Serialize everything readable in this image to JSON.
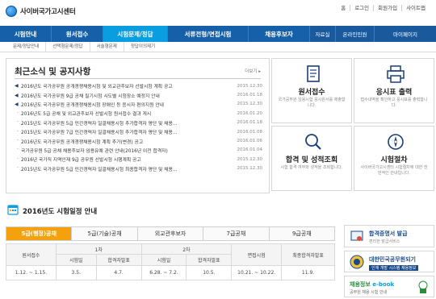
{
  "header": {
    "site_name": "사이버국가고시센터",
    "util": [
      "홈",
      "로그인",
      "회원가입",
      "사이트맵"
    ]
  },
  "gnb": {
    "items": [
      "시험안내",
      "원서접수",
      "시험문제/정답",
      "서류전형/면접시험",
      "채용후보자",
      "자료실",
      "온라인민원",
      "마이페이지"
    ],
    "active_index": 2
  },
  "snb": {
    "items": [
      "문제/정답안내",
      "선택형문제/정답",
      "서술형문제",
      "정답이의제기"
    ]
  },
  "news": {
    "title": "최근소식 및 공지사항",
    "more": "더보기",
    "items": [
      {
        "type": "notice",
        "title": "2016년도 국가공무원 공개경쟁채용시험 및 외교관후보자 선발시험 계획 공고",
        "date": "2015.12.30"
      },
      {
        "type": "notice",
        "title": "2016년도 국가공무원 9급 공채 필기시험 시도별 시험장소 예정지 안내",
        "date": "2016.01.18"
      },
      {
        "type": "notice",
        "title": "2016년도 국가공무원 공개경쟁채용시험 장애인 등 응시자 편의지원 안내",
        "date": "2015.12.30"
      },
      {
        "type": "bullet",
        "title": "2016년도 5급 공채 및 외교관후보자 선발시험 원서접수 결과 게시",
        "date": "2016.01.20"
      },
      {
        "type": "bullet",
        "title": "2015년도 국가공무원 5급 민간경력자 일괄채용시험 추가합격자 명단 및 채용...",
        "date": "2016.01.18"
      },
      {
        "type": "bullet",
        "title": "2015년도 국가공무원 7급 민간경력자 일괄채용시험 추가합격자 명단 및 채용...",
        "date": "2016.01.08"
      },
      {
        "type": "bullet",
        "title": "2016년도 국가공무원 공개경쟁채용시험 계획 추가(변경) 공고",
        "date": "2016.01.06"
      },
      {
        "type": "bullet",
        "title": "국가공무원 5급 공채 채용후보자 임용유예 관련 안내(2016년 이전 합격자)",
        "date": "2016.01.04"
      },
      {
        "type": "bullet",
        "title": "2016년 국가직 지역인재 9급 공무원 선발시험 시행계획 공고",
        "date": "2015.12.30"
      },
      {
        "type": "bullet",
        "title": "2015년도 국가공무원 5급 민간경력자 일괄채용시험 최종합격자 명단 및 채용...",
        "date": "2015.12.30"
      }
    ]
  },
  "tiles": [
    {
      "name": "원서접수",
      "desc": "국가공무원 임용시험 응시원서를 제출합니다."
    },
    {
      "name": "응시표 출력",
      "desc": "접수내역을 확인하고 응시표를 출력합니다."
    },
    {
      "name": "합격 및 성적조회",
      "desc": "시험 합격 여부와 성적을 조회합니다."
    },
    {
      "name": "시험절차",
      "desc": "사이버국가고시센터 시험절차에 대한 전반적인 안내입니다."
    }
  ],
  "schedule": {
    "title": "2016년도 시험일정 안내",
    "tabs": [
      "5급(행정)공채",
      "5급(기술)공채",
      "외교관후보자",
      "7급공채",
      "9급공채"
    ],
    "active_tab": 0,
    "header_top": [
      "원서접수",
      "1차",
      "2차",
      "면접시험",
      "최종합격자발표"
    ],
    "header_sub": [
      "시험일",
      "합격자발표",
      "시험일",
      "합격자발표"
    ],
    "row": [
      "1.12. ~ 1.15.",
      "3.5.",
      "4.7.",
      "6.28. ~ 7.2.",
      "10.5.",
      "10.21. ~ 10.22.",
      "11.9."
    ]
  },
  "banners": [
    {
      "title": "합격증명서 발급",
      "sub": "편리한 발급서비스"
    },
    {
      "title": "대한민국공무원되기",
      "sub": "인재 개발 시스템 채용정보"
    },
    {
      "title": "채용정보",
      "title2": "e-book",
      "sub": "공무원 채용 시험 안내"
    }
  ],
  "colors": {
    "gnb": "#1560a8",
    "gnb_active": "#0a9ee0",
    "tab_active": "#f3a20e",
    "icon_blue": "#1c3e7a"
  }
}
